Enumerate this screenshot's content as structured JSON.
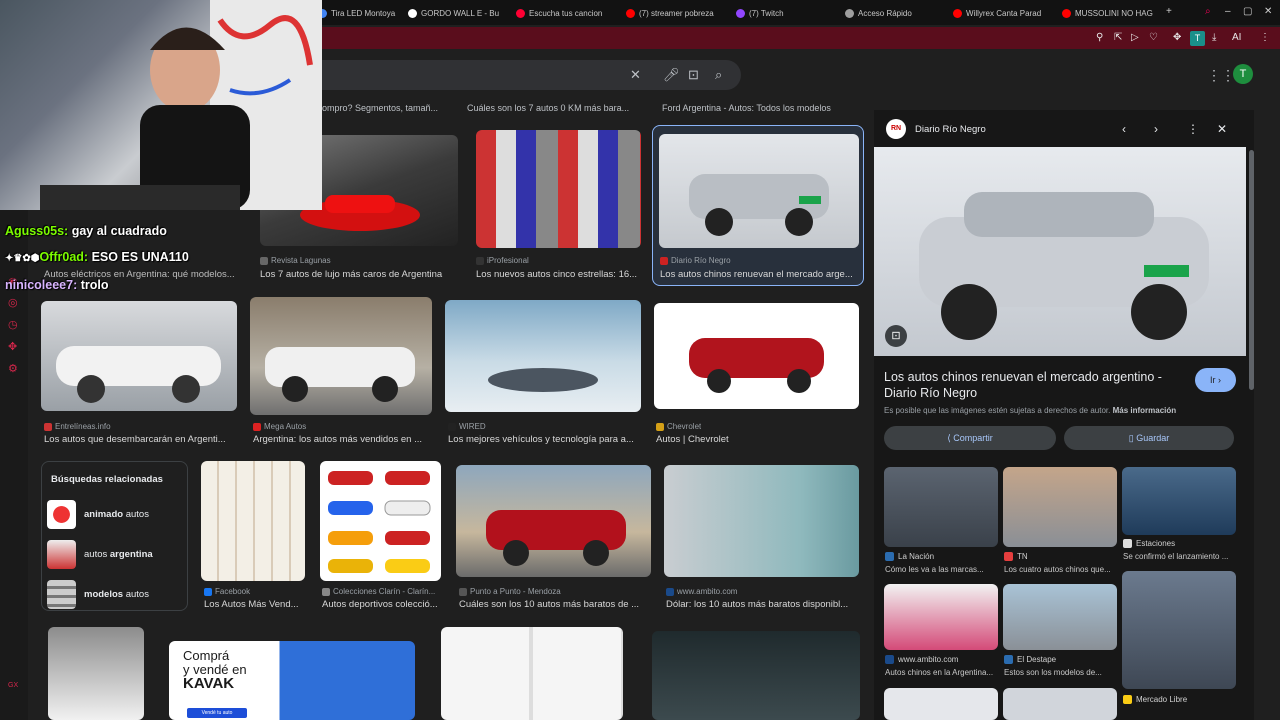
{
  "tabs": [
    {
      "label": "Tira LED Montoya",
      "color": "#4285f4"
    },
    {
      "label": "GORDO WALL E - Bu",
      "color": "#ffffff"
    },
    {
      "label": "Escucha tus cancion",
      "color": "#ff0033"
    },
    {
      "label": "(7) streamer pobreza",
      "color": "#ff0000"
    },
    {
      "label": "(7) Twitch",
      "color": "#9146ff"
    },
    {
      "label": "Acceso Rápido",
      "color": "#9e9e9e"
    },
    {
      "label": "Willyrex Canta Parad",
      "color": "#ff0000"
    },
    {
      "label": "MUSSOLINI NO HAG",
      "color": "#ff0000"
    }
  ],
  "toolbar": {
    "ai_label": "AI",
    "ext_letter": "T"
  },
  "search": {
    "clear_icon": "close-icon",
    "mic_icon": "mic-icon",
    "lens_icon": "lens-icon",
    "search_icon": "search-icon"
  },
  "account": {
    "initial": "T"
  },
  "chat": [
    {
      "user": "Aguss05s:",
      "msg": "gay al cuadrado"
    },
    {
      "user": "Offr0ad:",
      "msg": "ESO ES UNA110"
    },
    {
      "user": "ninicoleee7:",
      "msg": "trolo"
    }
  ],
  "top_row": [
    "ompro? Segmentos, tamañ...",
    "Cuáles son los 7 autos 0 KM más bara...",
    "Ford Argentina - Autos: Todos los modelos"
  ],
  "row1": [
    {
      "source": "",
      "caption": "Autos eléctricos en Argentina: qué modelos..."
    },
    {
      "source": "Revista Lagunas",
      "caption": "Los 7 autos de lujo más caros de Argentina"
    },
    {
      "source": "iProfesional",
      "caption": "Los nuevos autos cinco estrellas: 16..."
    },
    {
      "source": "Diario Río Negro",
      "caption": "Los autos chinos renuevan el mercado arge..."
    }
  ],
  "row2": [
    {
      "source": "Entrelíneas.info",
      "caption": "Los autos que desembarcarán en Argenti..."
    },
    {
      "source": "Mega Autos",
      "caption": "Argentina: los autos más vendidos en ..."
    },
    {
      "source": "WIRED",
      "caption": "Los mejores vehículos y tecnología para a..."
    },
    {
      "source": "Chevrolet",
      "caption": "Autos | Chevrolet"
    }
  ],
  "related": {
    "title": "Búsquedas relacionadas",
    "items": [
      {
        "bold": "animado",
        "rest": " autos",
        "bold_first": true
      },
      {
        "bold": "argentina",
        "rest": "autos ",
        "bold_first": false
      },
      {
        "bold": "modelos",
        "rest": " autos",
        "bold_first": true
      }
    ]
  },
  "row3": [
    {
      "source": "Facebook",
      "caption": "Los Autos Más Vend..."
    },
    {
      "source": "Colecciones Clarín - Clarín...",
      "caption": "Autos deportivos colecció..."
    },
    {
      "source": "Punto a Punto - Mendoza",
      "caption": "Cuáles son los 10 autos más baratos de ..."
    },
    {
      "source": "www.ambito.com",
      "caption": "Dólar: los 10 autos más baratos disponibl..."
    }
  ],
  "kavak_ad": {
    "line1": "Comprá",
    "line2": "y vendé en",
    "brand": "KAVAK",
    "button": "Vendé tu auto"
  },
  "panel": {
    "logo": "RN",
    "source": "Diario Río Negro",
    "title": "Los autos chinos renuevan el mercado argentino - Diario Río Negro",
    "go_button": "Ir",
    "copyright": "Es posible que las imágenes estén sujetas a derechos de autor.",
    "more_info": "Más información",
    "share": "Compartir",
    "save": "Guardar",
    "related": [
      {
        "source": "La Nación",
        "caption": "Cómo les va a las marcas..."
      },
      {
        "source": "TN",
        "caption": "Los cuatro autos chinos que..."
      },
      {
        "source": "Estaciones",
        "caption": "Se confirmó el lanzamiento ..."
      },
      {
        "source": "www.ambito.com",
        "caption": "Autos chinos en la Argentina..."
      },
      {
        "source": "El Destape",
        "caption": "Estos son los modelos de..."
      },
      {
        "source": "Mercado Libre",
        "caption": ""
      }
    ]
  },
  "colors": {
    "accent": "#8ab4f8",
    "addrbar": "#5a0d1c",
    "bg": "#1f1f1f"
  }
}
